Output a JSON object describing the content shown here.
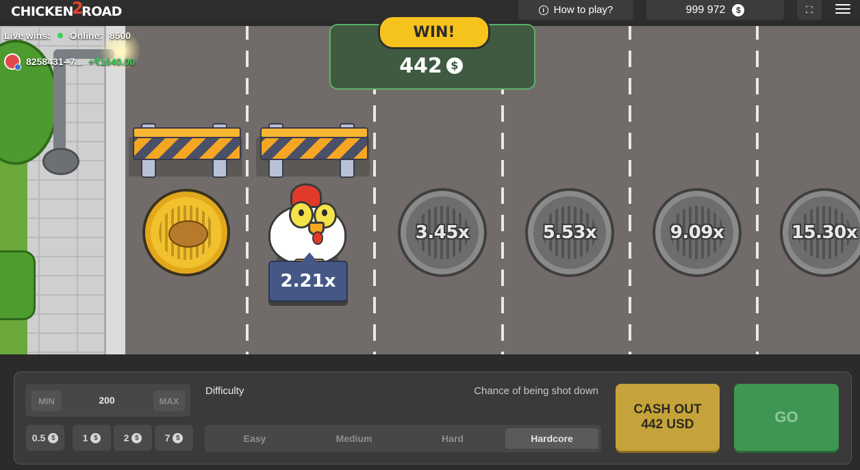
{
  "header": {
    "logo_text_a": "CHICKEN",
    "logo_text_2": "2",
    "logo_text_b": "ROAD",
    "how_to_play": "How to play?",
    "balance": "999 972",
    "currency_symbol": "$"
  },
  "live": {
    "label": "Live wins:",
    "online_label": "Online:",
    "online_count": "8500",
    "recent_user": "8258431--7...",
    "recent_amount": "+₹1640.00"
  },
  "game": {
    "win_label": "WIN!",
    "win_amount": "442",
    "current_multiplier": "2.21x",
    "upcoming_multipliers": [
      "3.45x",
      "5.53x",
      "9.09x",
      "15.30x"
    ]
  },
  "controls": {
    "min_label": "MIN",
    "max_label": "MAX",
    "bet_value": "200",
    "quick_bets": [
      "0.5",
      "1",
      "2",
      "7"
    ],
    "difficulty_title": "Difficulty",
    "chance_label": "Chance of being shot down",
    "difficulties": [
      "Easy",
      "Medium",
      "Hard",
      "Hardcore"
    ],
    "selected_difficulty": "Hardcore",
    "cashout_line1": "CASH OUT",
    "cashout_line2": "442 USD",
    "go_label": "GO"
  },
  "colors": {
    "road": "#716c69",
    "win_panel": "#3f5a41",
    "cashout": "#c6a33a",
    "go": "#3f9653",
    "multiplier_badge": "#455885"
  }
}
